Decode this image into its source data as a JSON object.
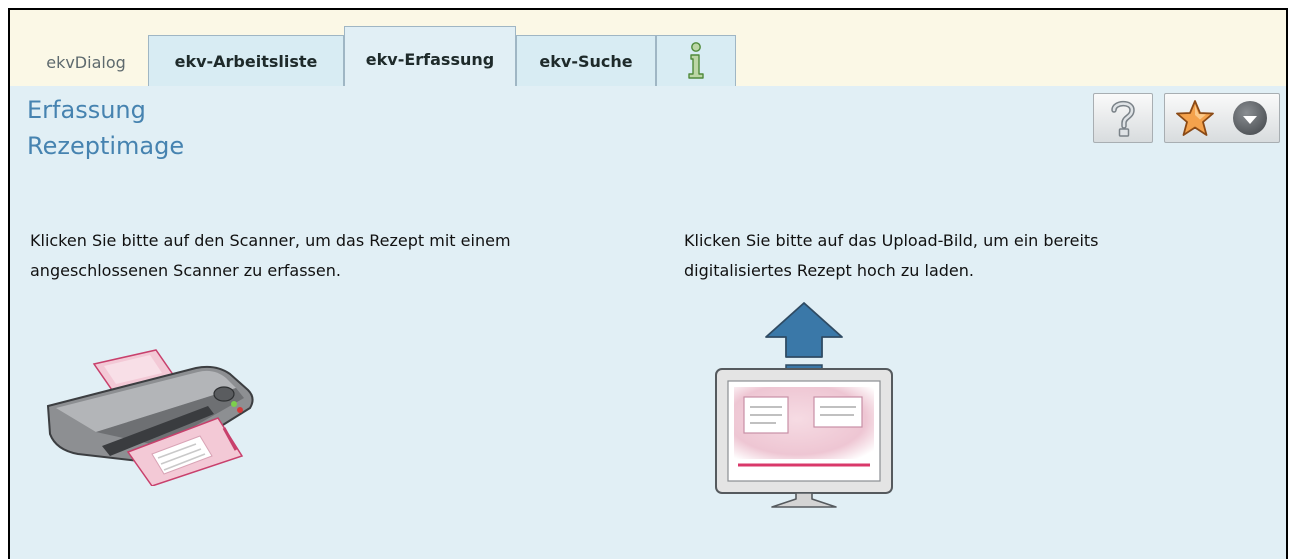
{
  "tabs": {
    "app": "ekvDialog",
    "worklist": "ekv-Arbeitsliste",
    "capture": "ekv-Erfassung",
    "search": "ekv-Suche",
    "info_icon": "info-icon"
  },
  "header": {
    "title_line1": "Erfassung",
    "title_line2": "Rezeptimage"
  },
  "toolbar": {
    "help_icon": "question-mark-icon",
    "favorites_icon": "star-icon",
    "favorites_menu_icon": "caret-down-icon"
  },
  "main": {
    "scanner_instruction_line1": "Klicken Sie bitte auf den Scanner, um das Rezept mit einem",
    "scanner_instruction_line2": "angeschlossenen Scanner zu erfassen.",
    "upload_instruction_line1": "Klicken Sie bitte auf das Upload-Bild, um ein bereits",
    "upload_instruction_line2": "digitalisiertes Rezept hoch zu laden.",
    "scanner_image": "scanner-icon",
    "upload_image": "upload-monitor-icon"
  },
  "colors": {
    "tab_bar_bg": "#fbf8e6",
    "panel_bg": "#e1eff5",
    "title_blue": "#4683b0",
    "arrow_blue": "#3a78a8",
    "accent_pink": "#d9386a"
  }
}
